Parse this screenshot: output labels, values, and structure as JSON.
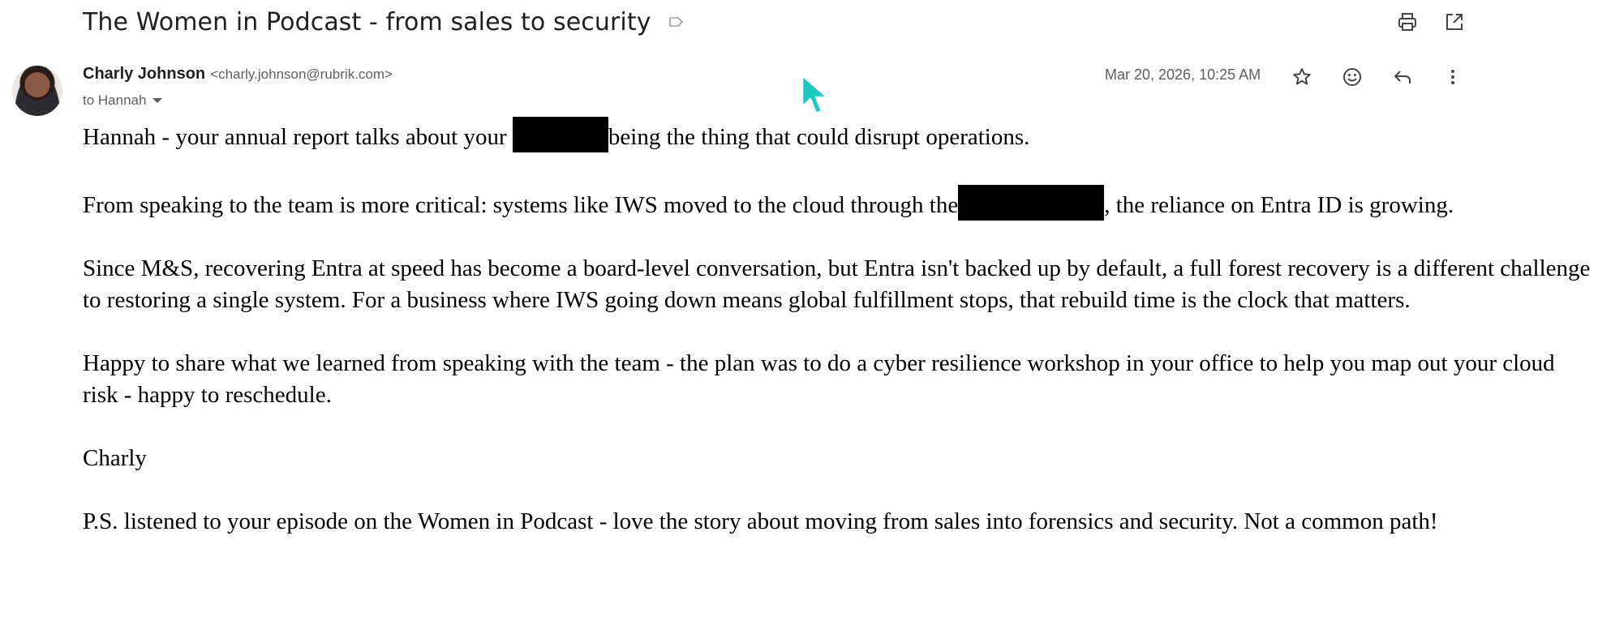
{
  "email": {
    "subject": "The Women in Podcast - from sales to security",
    "sender": {
      "name": "Charly Johnson",
      "email": "<charly.johnson@rubrik.com>"
    },
    "to_label": "to Hannah",
    "date": "Mar 20, 2026, 10:25 AM",
    "body": {
      "p1_before": "Hannah - your annual report talks about your ",
      "p1_after": "being the thing that could disrupt operations.",
      "p2_before": "From speaking to the team is more critical: systems like IWS moved to the cloud through the",
      "p2_after": ", the reliance on Entra ID is growing.",
      "p3": "Since M&S, recovering Entra at speed has become a board-level conversation, but Entra isn't backed up by default, a full forest recovery is a different challenge to restoring a single system. For a business where IWS going down means global fulfillment stops, that rebuild time is the clock that matters.",
      "p4": "Happy to share what we learned from speaking with the team - the plan was to do a cyber resilience workshop in your office to help you map out your cloud risk - happy to reschedule.",
      "signature": "Charly",
      "ps": "P.S. listened to your episode on the Women in Podcast - love the story about moving from sales into forensics and security. Not a common path!"
    }
  },
  "icons": {
    "label": "label-outline-icon",
    "print": "print-icon",
    "open_new_window": "open-in-new-icon",
    "star": "star-outline-icon",
    "emoji": "emoji-reaction-icon",
    "reply": "reply-icon",
    "more": "more-vertical-icon",
    "cursor": "mouse-cursor-icon"
  },
  "colors": {
    "text_primary": "#1f1f1f",
    "text_secondary": "#5e5e5e",
    "icon": "#444746",
    "cursor": "#1cc8c3",
    "redaction": "#000000"
  }
}
